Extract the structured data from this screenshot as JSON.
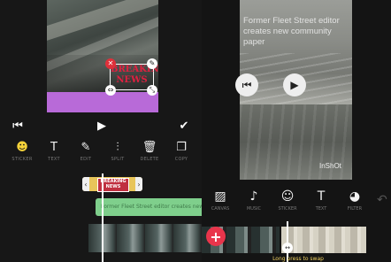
{
  "left": {
    "sticker_text": "BREAKING NEWS",
    "sticker_chip_text": "BREAKING NEWS",
    "toolbar": [
      {
        "icon": "sticker-smile-icon",
        "glyph": "☻",
        "label": "STICKER"
      },
      {
        "icon": "text-icon",
        "glyph": "T",
        "label": "TEXT"
      },
      {
        "icon": "pencil-icon",
        "glyph": "✎",
        "label": "EDIT"
      },
      {
        "icon": "split-icon",
        "glyph": "⫶",
        "label": "SPLIT"
      },
      {
        "icon": "trash-icon",
        "glyph": "🗑",
        "label": "DELETE"
      },
      {
        "icon": "copy-icon",
        "glyph": "❐",
        "label": "COPY"
      }
    ],
    "text_track_label": "Former Fleet Street editor creates new"
  },
  "right": {
    "caption": "Former Fleet Street editor creates new community paper",
    "watermark": "InShOt",
    "toolbar": [
      {
        "icon": "canvas-icon",
        "glyph": "▨",
        "label": "CANVAS"
      },
      {
        "icon": "music-icon",
        "glyph": "♪",
        "label": "MUSIC"
      },
      {
        "icon": "sticker-icon",
        "glyph": "☺",
        "label": "STICKER"
      },
      {
        "icon": "text-icon",
        "glyph": "T",
        "label": "TEXT"
      },
      {
        "icon": "filter-icon",
        "glyph": "◕",
        "label": "FILTER"
      }
    ],
    "hint": "Long press to swap"
  },
  "colors": {
    "accent_red": "#e9354b",
    "sticker_yellow": "#f6d33a",
    "text_track_green": "#7fcf8c",
    "purple_band": "#b86ad8"
  }
}
